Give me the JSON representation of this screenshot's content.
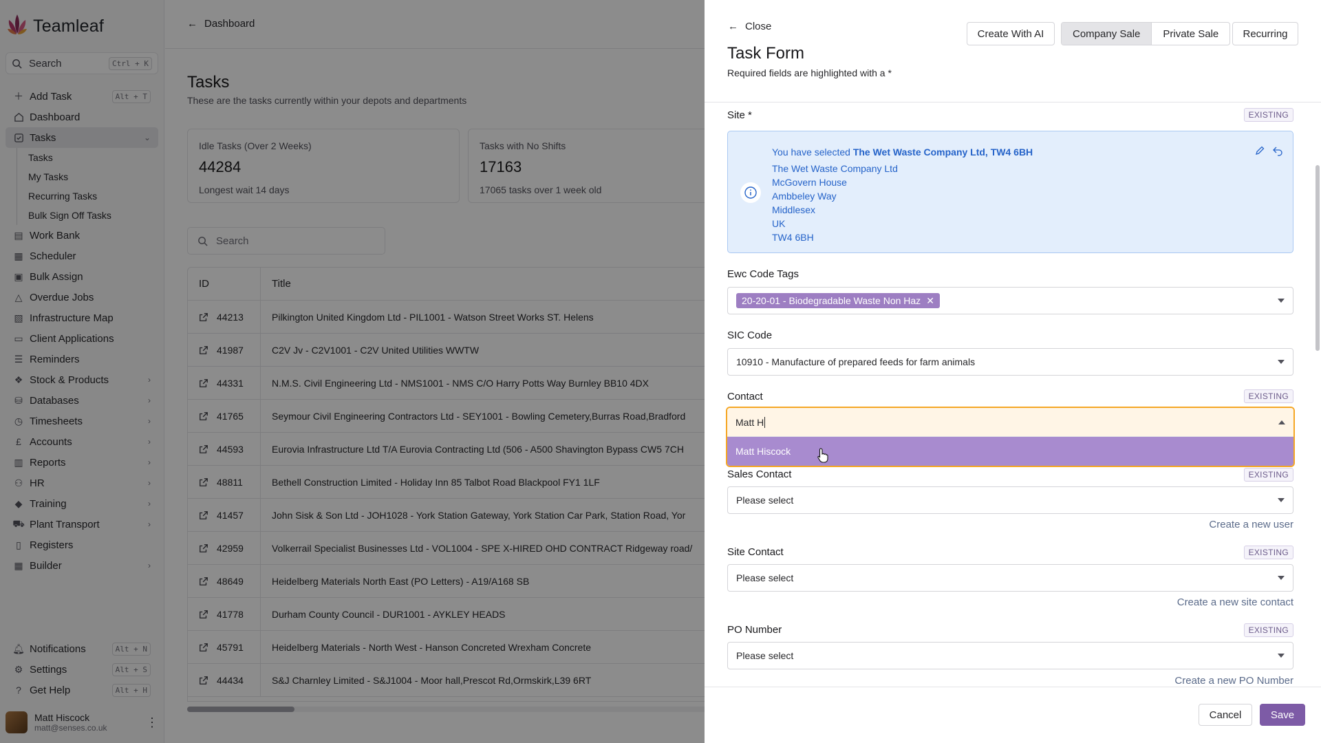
{
  "app": {
    "name": "Teamleaf",
    "search_label": "Search",
    "search_shortcut": "Ctrl + K"
  },
  "sidebar": {
    "items": [
      {
        "label": "Add Task",
        "icon": "plus-icon",
        "shortcut": "Alt + T"
      },
      {
        "label": "Dashboard",
        "icon": "home-icon"
      },
      {
        "label": "Tasks",
        "icon": "checkbox-icon",
        "expanded": true
      },
      {
        "label": "Work Bank",
        "icon": "clipboard-icon"
      },
      {
        "label": "Scheduler",
        "icon": "calendar-icon"
      },
      {
        "label": "Bulk Assign",
        "icon": "clipboard-check-icon"
      },
      {
        "label": "Overdue Jobs",
        "icon": "warning-icon"
      },
      {
        "label": "Infrastructure Map",
        "icon": "map-icon"
      },
      {
        "label": "Client Applications",
        "icon": "window-icon"
      },
      {
        "label": "Reminders",
        "icon": "list-icon"
      },
      {
        "label": "Stock & Products",
        "icon": "cubes-icon"
      },
      {
        "label": "Databases",
        "icon": "database-icon"
      },
      {
        "label": "Timesheets",
        "icon": "clock-icon"
      },
      {
        "label": "Accounts",
        "icon": "pound-icon"
      },
      {
        "label": "Reports",
        "icon": "bar-chart-icon"
      },
      {
        "label": "HR",
        "icon": "users-icon"
      },
      {
        "label": "Training",
        "icon": "graduation-cap-icon"
      },
      {
        "label": "Plant Transport",
        "icon": "truck-icon"
      },
      {
        "label": "Registers",
        "icon": "book-icon"
      },
      {
        "label": "Builder",
        "icon": "grid-icon"
      }
    ],
    "task_subitems": [
      "Tasks",
      "My Tasks",
      "Recurring Tasks",
      "Bulk Sign Off Tasks"
    ],
    "bottom": [
      {
        "label": "Notifications",
        "icon": "bell-icon",
        "shortcut": "Alt + N"
      },
      {
        "label": "Settings",
        "icon": "gear-icon",
        "shortcut": "Alt + S"
      },
      {
        "label": "Get Help",
        "icon": "help-icon",
        "shortcut": "Alt + H"
      }
    ],
    "user": {
      "name": "Matt Hiscock",
      "email": "matt@senses.co.uk"
    }
  },
  "main": {
    "breadcrumb": "Dashboard",
    "title": "Tasks",
    "subtitle": "These are the tasks currently within your depots and departments",
    "stats": [
      {
        "label": "Idle Tasks (Over 2 Weeks)",
        "value": "44284",
        "sub": "Longest wait 14 days"
      },
      {
        "label": "Tasks with No Shifts",
        "value": "17163",
        "sub": "17065 tasks over 1 week old"
      }
    ],
    "search_placeholder": "Search",
    "columns": [
      "ID",
      "Title"
    ],
    "rows": [
      {
        "id": "44213",
        "title": "Pilkington United Kingdom Ltd - PIL1001 - Watson Street Works ST. Helens"
      },
      {
        "id": "41987",
        "title": "C2V Jv - C2V1001 - C2V United Utilities WWTW"
      },
      {
        "id": "44331",
        "title": "N.M.S. Civil Engineering Ltd - NMS1001 - NMS C/O Harry Potts Way Burnley BB10 4DX"
      },
      {
        "id": "41765",
        "title": "Seymour Civil Engineering Contractors Ltd - SEY1001 - Bowling Cemetery,Burras Road,Bradford"
      },
      {
        "id": "44593",
        "title": "Eurovia Infrastructure Ltd T/A Eurovia Contracting Ltd (506 - A500 Shavington Bypass CW5 7CH"
      },
      {
        "id": "48811",
        "title": "Bethell Construction Limited - Holiday Inn 85 Talbot Road Blackpool FY1 1LF"
      },
      {
        "id": "41457",
        "title": "John Sisk & Son Ltd - JOH1028 - York Station Gateway, York Station Car Park, Station Road, Yor"
      },
      {
        "id": "42959",
        "title": "Volkerrail Specialist Businesses Ltd - VOL1004 - SPE X-HIRED OHD CONTRACT Ridgeway road/"
      },
      {
        "id": "48649",
        "title": "Heidelberg Materials North East (PO Letters) - A19/A168 SB"
      },
      {
        "id": "41778",
        "title": "Durham County Council - DUR1001 - AYKLEY HEADS"
      },
      {
        "id": "45791",
        "title": "Heidelberg Materials - North West - Hanson Concreted Wrexham Concrete"
      },
      {
        "id": "44434",
        "title": "S&J Charnley Limited - S&J1004 - Moor hall,Prescot Rd,Ormskirk,L39 6RT"
      }
    ]
  },
  "drawer": {
    "close_label": "Close",
    "title": "Task Form",
    "subtitle": "Required fields are highlighted with a *",
    "create_ai_label": "Create With AI",
    "sale_tabs": [
      "Company Sale",
      "Private Sale"
    ],
    "recurring_label": "Recurring",
    "existing_badge": "EXISTING",
    "site": {
      "label": "Site *",
      "selected_prefix": "You have selected",
      "selected_name": "The Wet Waste Company Ltd, TW4 6BH",
      "address": [
        "The Wet Waste Company Ltd",
        "McGovern House",
        "Ambbeley Way",
        "Middlesex",
        "UK",
        "TW4 6BH"
      ]
    },
    "ewc": {
      "label": "Ewc Code Tags",
      "tag": "20-20-01 - Biodegradable Waste Non Haz"
    },
    "sic": {
      "label": "SIC Code",
      "value": "10910 - Manufacture of prepared feeds for farm animals"
    },
    "contact": {
      "label": "Contact",
      "input_value": "Matt H",
      "option": "Matt Hiscock"
    },
    "sales_contact": {
      "label": "Sales Contact",
      "placeholder": "Please select",
      "create_link": "Create a new user"
    },
    "site_contact": {
      "label": "Site Contact",
      "placeholder": "Please select",
      "create_link": "Create a new site contact"
    },
    "po_number": {
      "label": "PO Number",
      "placeholder": "Please select",
      "create_link": "Create a new PO Number"
    },
    "cancel_label": "Cancel",
    "save_label": "Save"
  },
  "colors": {
    "accent": "#7d5ba6",
    "info_bg": "#e3eefc",
    "info_text": "#2563c9",
    "focus_ring": "#f5a623"
  }
}
